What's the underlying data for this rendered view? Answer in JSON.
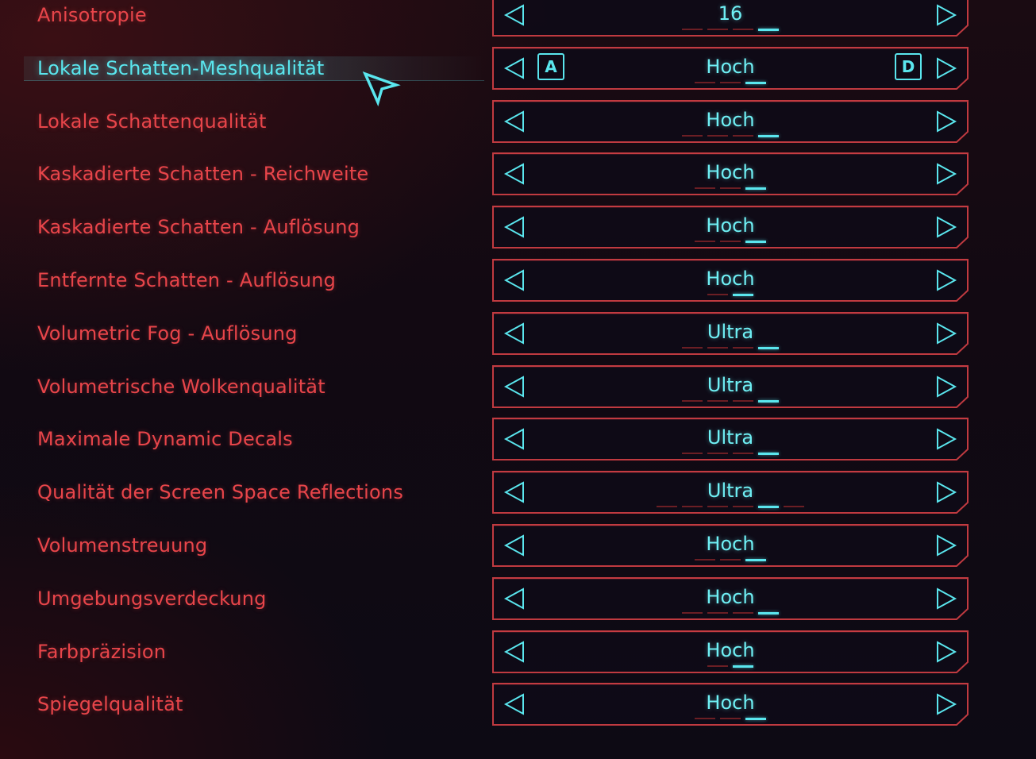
{
  "theme": {
    "label_color": "#e8454a",
    "selected_label_color": "#5ae6ee",
    "value_color": "#6ff0f5",
    "frame_color": "#c03a40"
  },
  "rows": [
    {
      "label": "Anisotropie",
      "value": "16",
      "ticks": 4,
      "active": 3,
      "selected": false
    },
    {
      "label": "Lokale Schatten-Meshqualität",
      "value": "Hoch",
      "ticks": 3,
      "active": 2,
      "selected": true,
      "key_left": "A",
      "key_right": "D"
    },
    {
      "label": "Lokale Schattenqualität",
      "value": "Hoch",
      "ticks": 4,
      "active": 3,
      "selected": false
    },
    {
      "label": "Kaskadierte Schatten - Reichweite",
      "value": "Hoch",
      "ticks": 3,
      "active": 2,
      "selected": false
    },
    {
      "label": "Kaskadierte Schatten - Auflösung",
      "value": "Hoch",
      "ticks": 3,
      "active": 2,
      "selected": false
    },
    {
      "label": "Entfernte Schatten - Auflösung",
      "value": "Hoch",
      "ticks": 2,
      "active": 1,
      "selected": false
    },
    {
      "label": "Volumetric Fog - Auflösung",
      "value": "Ultra",
      "ticks": 4,
      "active": 3,
      "selected": false
    },
    {
      "label": "Volumetrische Wolkenqualität",
      "value": "Ultra",
      "ticks": 4,
      "active": 3,
      "selected": false
    },
    {
      "label": "Maximale Dynamic Decals",
      "value": "Ultra",
      "ticks": 4,
      "active": 3,
      "selected": false
    },
    {
      "label": "Qualität der Screen Space Reflections",
      "value": "Ultra",
      "ticks": 6,
      "active": 4,
      "selected": false
    },
    {
      "label": "Volumenstreuung",
      "value": "Hoch",
      "ticks": 3,
      "active": 2,
      "selected": false
    },
    {
      "label": "Umgebungsverdeckung",
      "value": "Hoch",
      "ticks": 4,
      "active": 3,
      "selected": false
    },
    {
      "label": "Farbpräzision",
      "value": "Hoch",
      "ticks": 2,
      "active": 1,
      "selected": false
    },
    {
      "label": "Spiegelqualität",
      "value": "Hoch",
      "ticks": 3,
      "active": 2,
      "selected": false
    }
  ]
}
